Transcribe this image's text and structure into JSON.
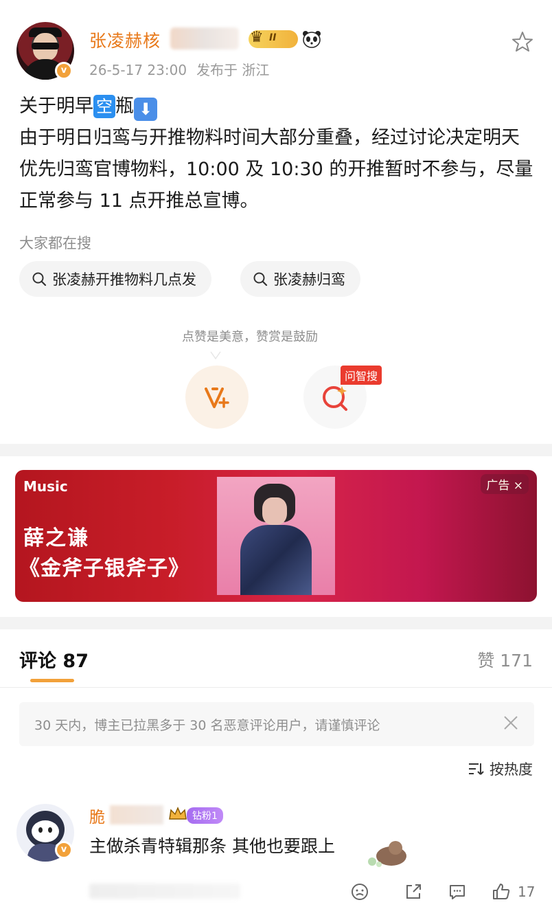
{
  "post": {
    "author": "张凌赫核",
    "level_badge": "II",
    "verified_mark": "v",
    "timestamp": "26-5-17 23:00",
    "published_from": "发布于 浙江",
    "line1_prefix": "关于明早",
    "line1_chip": "空",
    "line1_suffix": "瓶",
    "line1_arrow": "⬇",
    "body": "由于明日归鸾与开推物料时间大部分重叠，经过讨论决定明天优先归鸾官博物料，10:00 及 10:30 的开推暂时不参与，尽量正常参与 11 点开推总宣博。"
  },
  "search": {
    "title": "大家都在搜",
    "suggestions": [
      "张凌赫开推物料几点发",
      "张凌赫归鸾"
    ]
  },
  "reward_tip": "点赞是美意，赞赏是鼓励",
  "wenzhi_label": "问智搜",
  "ad": {
    "brand": "Music",
    "artist": "薛之谦",
    "song": "《金斧子银斧子》",
    "tag": "广告",
    "close": "×"
  },
  "comments": {
    "tab_label": "评论",
    "count": "87",
    "likes_label": "赞",
    "likes_count": "171",
    "notice": "30 天内，博主已拉黑多于 30 名恶意评论用户，请谨慎评论",
    "sort_label": "按热度",
    "items": [
      {
        "author": "脆",
        "fan_badge": "钻粉1",
        "text": "主做杀青特辑那条 其他也要跟上",
        "like_count": "17"
      }
    ]
  },
  "colors": {
    "accent_orange": "#e8791a",
    "verified": "#f2a13a",
    "wenzhi_red": "#ea3b2e",
    "fan_purple": "#a56cf0"
  },
  "icons": [
    "star-icon",
    "search-icon",
    "like-v-icon",
    "ai-search-icon",
    "close-icon",
    "sort-icon",
    "emoji-icon",
    "share-icon",
    "comment-icon",
    "thumb-up-icon",
    "crown-icon",
    "panda-icon"
  ]
}
